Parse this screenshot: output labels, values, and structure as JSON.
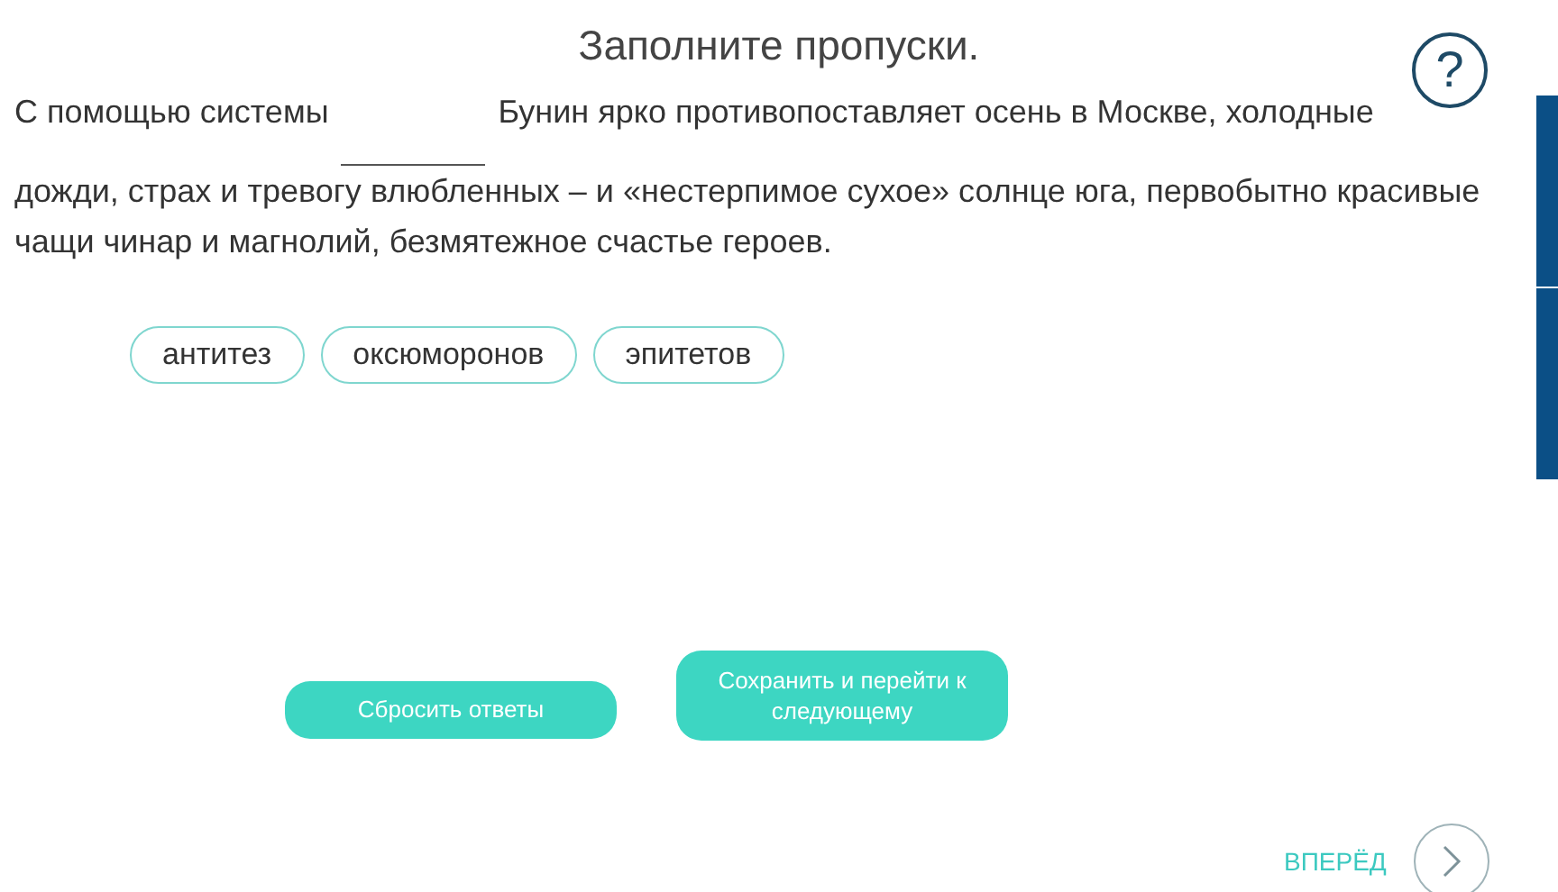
{
  "title": "Заполните пропуски.",
  "help_button": {
    "label": "?"
  },
  "question": {
    "parts": [
      {
        "kind": "text",
        "text": "С помощью системы"
      },
      {
        "kind": "blank"
      },
      {
        "kind": "text",
        "text": "Бунин ярко противопоставляет осень в Москве, холодные дожди, страх и тревогу влюбленных – и «нестерпимое сухое» солнце юга, первобытно красивые чащи чинар и магнолий, безмятежное счастье героев."
      }
    ]
  },
  "options": [
    {
      "label": "антитез"
    },
    {
      "label": "оксюморонов"
    },
    {
      "label": "эпитетов"
    }
  ],
  "buttons": [
    {
      "kind": "reset",
      "label": "Сбросить ответы"
    },
    {
      "kind": "save",
      "label": "Сохранить и перейти к следующему"
    }
  ],
  "next": {
    "label": "ВПЕРЁД"
  }
}
